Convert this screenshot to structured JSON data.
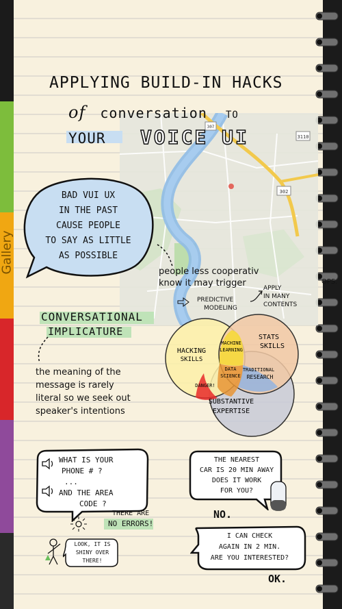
{
  "title": {
    "line1": "APPLYING BUILD-IN HACKS",
    "line2_prefix": "of",
    "line2_word": "conversation",
    "line2_suffix": "TO",
    "line3_your": "YOUR",
    "line3_voice": "VOICE UI"
  },
  "tab": {
    "label": "Gallery"
  },
  "bubble_main": {
    "line1": "BAD VUI UX",
    "line2": "IN THE PAST",
    "line3": "CAUSE PEOPLE",
    "line4": "TO SAY AS LITTLE",
    "line5": "AS POSSIBLE"
  },
  "notes": {
    "people1": "people less cooperativ",
    "people2": "know it may trigger",
    "predictive1": "PREDICTIVE",
    "predictive2": "MODELING",
    "apply1": "APPLY",
    "apply2": "IN MANY",
    "apply3": "CONTENTS",
    "ops": "OPS."
  },
  "implicature": {
    "line1": "CONVERSATIONAL",
    "line2": "IMPLICATURE",
    "desc1": "the meaning of the",
    "desc2": "message is rarely",
    "desc3": "literal so we seek out",
    "desc4": "speaker's intentions"
  },
  "venn": {
    "hacking1": "HACKING",
    "hacking2": "SKILLS",
    "stats1": "STATS",
    "stats2": "SKILLS",
    "ml1": "MACHINE",
    "ml2": "LEARNING",
    "ds1": "DATA",
    "ds2": "SCIENCE",
    "danger": "DANGER!",
    "trad1": "TRADITIONAL",
    "trad2": "RESEARCH",
    "subst1": "SUBSTANTIVE",
    "subst2": "EXPERTISE"
  },
  "map": {
    "route_badge_1": "3110",
    "route_badge_2": "302",
    "route_badge_3": "307"
  },
  "phone_bubble": {
    "line1": "WHAT IS YOUR",
    "line2": "PHONE # ?",
    "dots": "...",
    "line3": "AND THE AREA",
    "line4": "CODE ?"
  },
  "no_errors": {
    "line1": "THERE ARE",
    "line2": "NO ERRORS!"
  },
  "kid": {
    "line1": "LOOK, IT IS",
    "line2": "SHINY OVER",
    "line3": "THERE!"
  },
  "car_bubble": {
    "line1": "THE NEAREST",
    "line2": "CAR IS 20 MIN AWAY",
    "line3": "DOES IT WORK",
    "line4": "FOR YOU?"
  },
  "no": "NO.",
  "check_bubble": {
    "line1": "I CAN CHECK",
    "line2": "AGAIN IN 2 MIN.",
    "line3": "ARE YOU INTERESTED?"
  },
  "ok": "OK.",
  "colors": {
    "paper": "#f8f1de",
    "accent_blue": "#c8def2",
    "accent_green": "#bfe3b8",
    "tab_green": "#7dbd3c",
    "tab_yellow": "#f0a712",
    "tab_red": "#d8262a",
    "tab_purple": "#8f4a9b"
  }
}
